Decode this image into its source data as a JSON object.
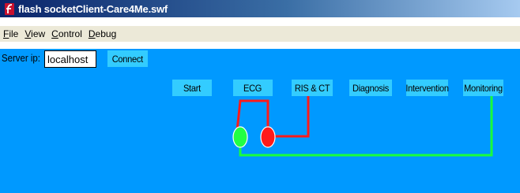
{
  "window": {
    "title": "flash socketClient-Care4Me.swf",
    "icon": "flash-player-icon"
  },
  "menu": [
    {
      "accel": "F",
      "rest": "ile"
    },
    {
      "accel": "V",
      "rest": "iew"
    },
    {
      "accel": "C",
      "rest": "ontrol"
    },
    {
      "accel": "D",
      "rest": "ebug"
    }
  ],
  "connection": {
    "label": "Server ip:",
    "value": "localhost",
    "connect_label": "Connect"
  },
  "steps": {
    "start": "Start",
    "ecg": "ECG",
    "ris_ct": "RIS & CT",
    "diagnosis": "Diagnosis",
    "intervention": "Intervention",
    "monitoring": "Monitoring"
  },
  "colors": {
    "stage": "#0099ff",
    "button": "#33ccff",
    "red_line": "#ff1a1a",
    "green_line": "#1aff3a"
  }
}
